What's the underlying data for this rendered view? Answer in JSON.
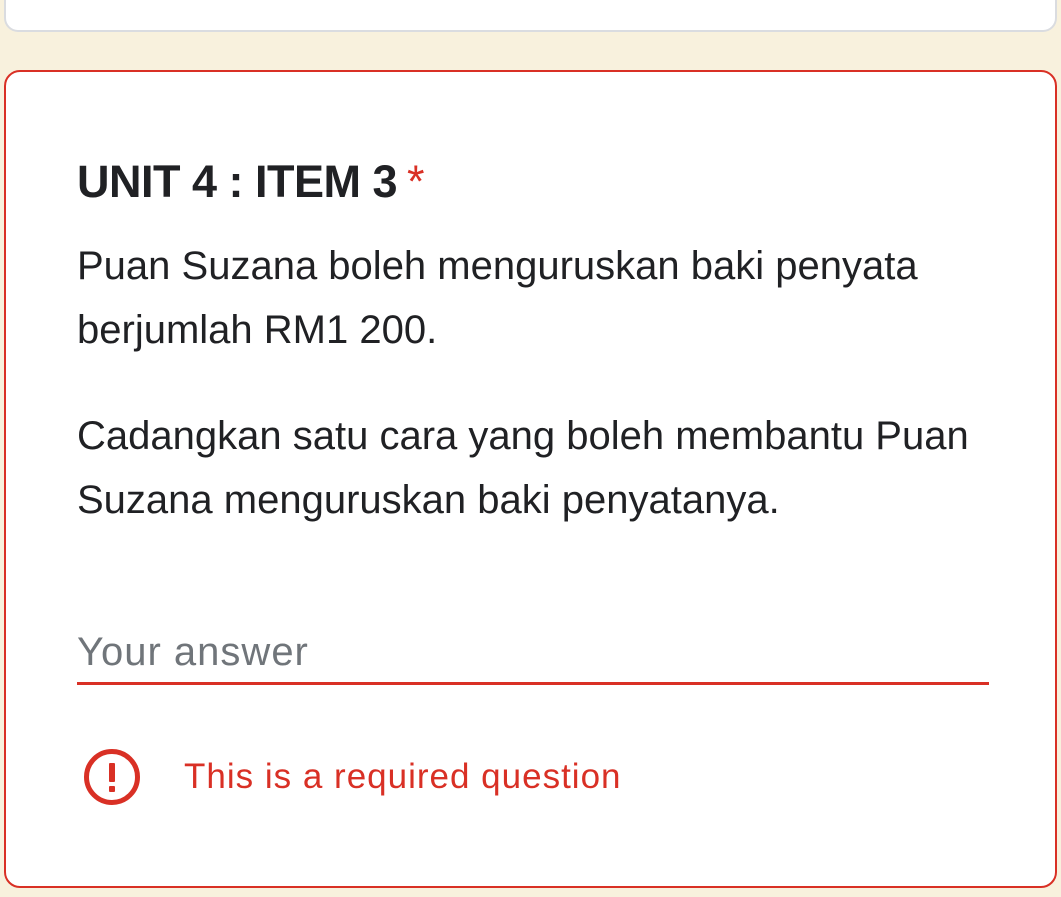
{
  "question": {
    "title": "UNIT 4 : ITEM 3",
    "required_marker": "*",
    "description_paragraphs": [
      "Puan Suzana boleh menguruskan baki penyata berjumlah RM1 200.",
      "Cadangkan satu cara yang boleh membantu Puan Suzana menguruskan baki penyatanya."
    ],
    "answer": {
      "value": "",
      "placeholder": "Your answer"
    },
    "error": {
      "icon": "error-circle-exclamation-icon",
      "message": "This is a required question"
    }
  },
  "colors": {
    "page_background": "#f8f1dd",
    "card_background": "#ffffff",
    "error_red": "#d93025",
    "text_primary": "#202124",
    "placeholder_gray": "#70757a"
  }
}
